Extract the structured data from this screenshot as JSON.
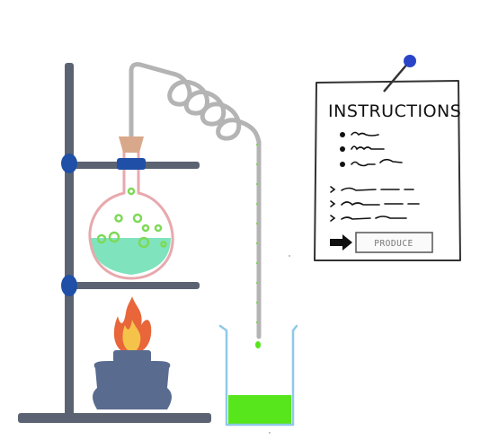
{
  "instructions": {
    "title": "INSTRUCTIONS",
    "produce_button_label": "PRODUCE"
  },
  "colors": {
    "stand": "#5b6372",
    "clamp": "#1f4fa6",
    "pin": "#2a44c8",
    "liquid_flask": "#7fe3bd",
    "bubbles": "#7ed957",
    "liquid_beaker": "#57e51c",
    "flask_outline": "#e7a9ad",
    "stopper": "#d9a88a",
    "coil": "#b4b4b4",
    "burner": "#5a6b90",
    "flame_outer": "#e8663a",
    "flame_inner": "#f5c34a",
    "beaker_outline": "#8fc9e8"
  },
  "icons": {
    "arrow": "right-arrow-icon",
    "pin": "push-pin-icon"
  }
}
